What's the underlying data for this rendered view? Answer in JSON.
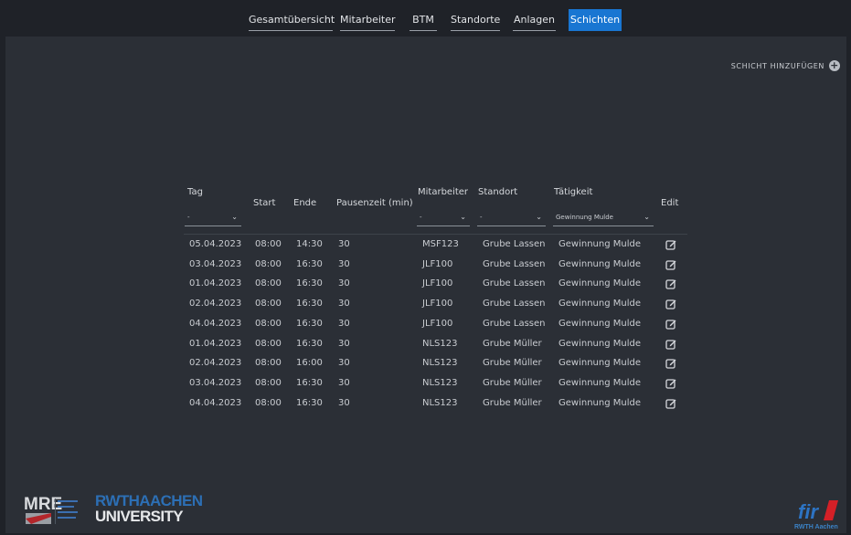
{
  "nav": [
    {
      "label": "Gesamtübersicht",
      "active": false
    },
    {
      "label": "Mitarbeiter",
      "active": false
    },
    {
      "label": "BTM",
      "active": false
    },
    {
      "label": "Standorte",
      "active": false
    },
    {
      "label": "Anlagen",
      "active": false
    },
    {
      "label": "Schichten",
      "active": true
    }
  ],
  "add_shift_label": "SCHICHT HINZUFÜGEN",
  "table": {
    "headers": {
      "tag": "Tag",
      "start": "Start",
      "ende": "Ende",
      "pause": "Pausenzeit (min)",
      "mitarbeiter": "Mitarbeiter",
      "standort": "Standort",
      "taetigkeit": "Tätigkeit",
      "edit": "Edit"
    },
    "filters": {
      "tag": "-",
      "mitarbeiter": "-",
      "standort": "-",
      "taetigkeit": "Gewinnung Mulde"
    },
    "rows": [
      [
        "05.04.2023",
        "08:00",
        "14:30",
        "30",
        "MSF123",
        "Grube Lassen",
        "Gewinnung Mulde"
      ],
      [
        "03.04.2023",
        "08:00",
        "16:30",
        "30",
        "JLF100",
        "Grube Lassen",
        "Gewinnung Mulde"
      ],
      [
        "01.04.2023",
        "08:00",
        "16:30",
        "30",
        "JLF100",
        "Grube Lassen",
        "Gewinnung Mulde"
      ],
      [
        "02.04.2023",
        "08:00",
        "16:30",
        "30",
        "JLF100",
        "Grube Lassen",
        "Gewinnung Mulde"
      ],
      [
        "04.04.2023",
        "08:00",
        "16:30",
        "30",
        "JLF100",
        "Grube Lassen",
        "Gewinnung Mulde"
      ],
      [
        "01.04.2023",
        "08:00",
        "16:30",
        "30",
        "NLS123",
        "Grube Müller",
        "Gewinnung Mulde"
      ],
      [
        "02.04.2023",
        "08:00",
        "16:00",
        "30",
        "NLS123",
        "Grube Müller",
        "Gewinnung Mulde"
      ],
      [
        "03.04.2023",
        "08:00",
        "16:30",
        "30",
        "NLS123",
        "Grube Müller",
        "Gewinnung Mulde"
      ],
      [
        "04.04.2023",
        "08:00",
        "16:30",
        "30",
        "NLS123",
        "Grube Müller",
        "Gewinnung Mulde"
      ]
    ]
  },
  "logos": {
    "mre": "MRE",
    "rwth_line1": "RWTHAACHEN",
    "rwth_line2": "UNIVERSITY",
    "fir": "fir",
    "fir_sub": "RWTH Aachen"
  },
  "colors": {
    "accent": "#1976d2",
    "background": "#2b2f36",
    "topbar": "#1f2228"
  }
}
